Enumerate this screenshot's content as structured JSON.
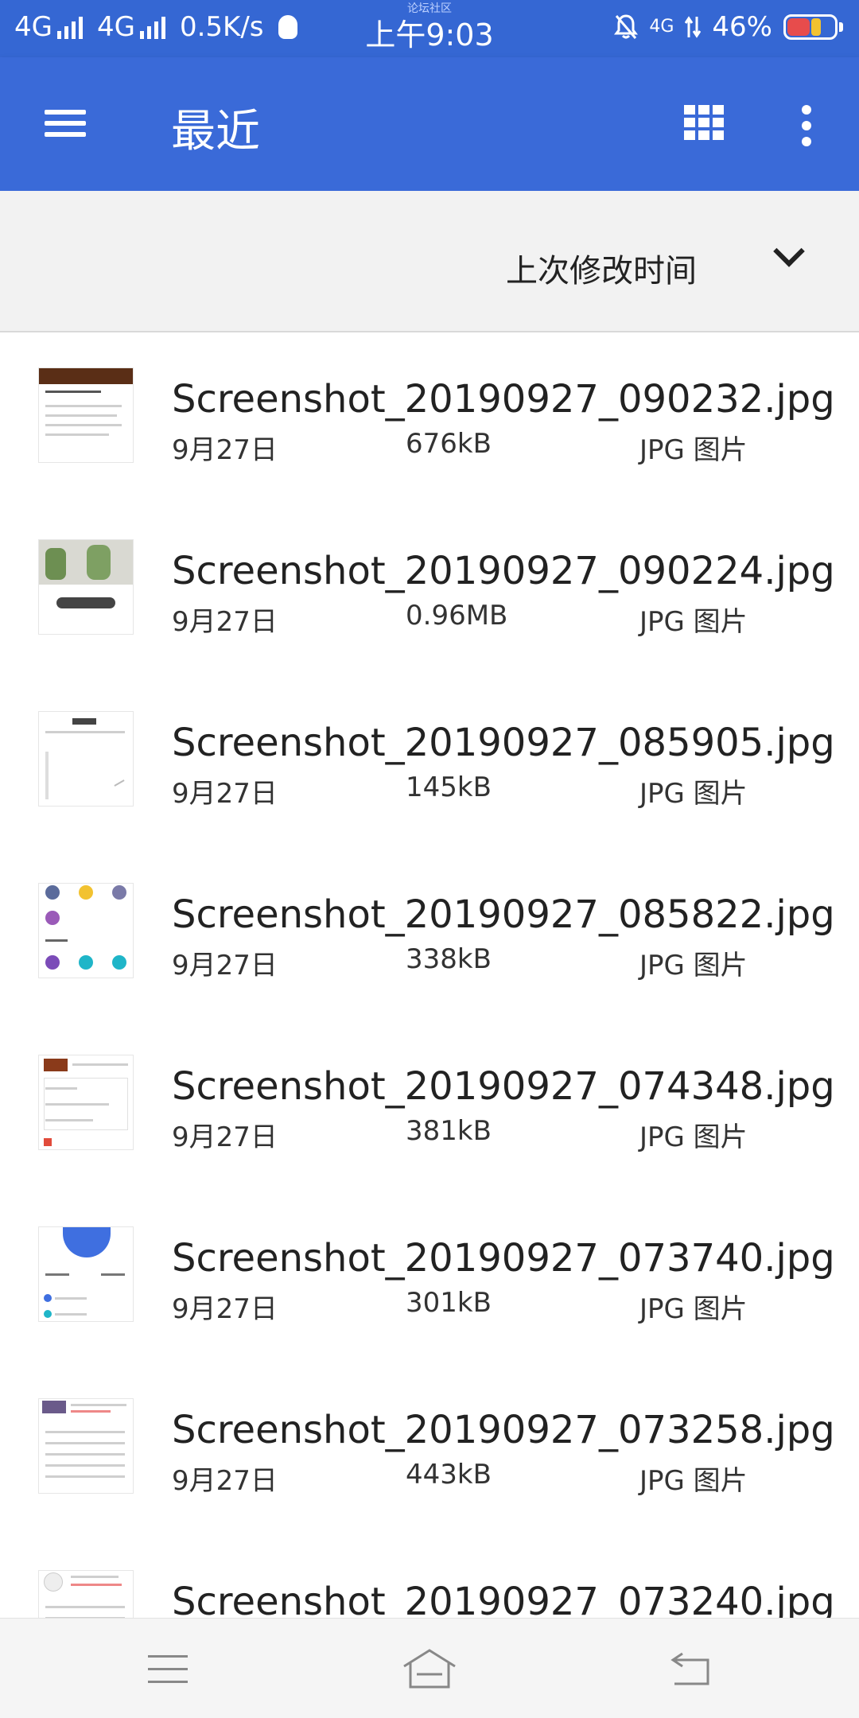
{
  "status_bar": {
    "net1": "4G",
    "net2": "4G",
    "speed": "0.5K/s",
    "time": "上午9:03",
    "community": "论坛社区",
    "net3": "4G",
    "battery": "46%",
    "battery_level": 0.46
  },
  "app_bar": {
    "title": "最近",
    "menu_icon": "hamburger-menu-icon",
    "grid_icon": "grid-view-icon",
    "more_icon": "more-vert-icon",
    "accent_color": "#3a6ad8"
  },
  "sort": {
    "label": "上次修改时间",
    "icon": "chevron-down-icon"
  },
  "files": [
    {
      "name": "Screenshot_20190927_090232.jpg",
      "date": "9月27日",
      "size": "676kB",
      "type": "JPG 图片"
    },
    {
      "name": "Screenshot_20190927_090224.jpg",
      "date": "9月27日",
      "size": "0.96MB",
      "type": "JPG 图片"
    },
    {
      "name": "Screenshot_20190927_085905.jpg",
      "date": "9月27日",
      "size": "145kB",
      "type": "JPG 图片"
    },
    {
      "name": "Screenshot_20190927_085822.jpg",
      "date": "9月27日",
      "size": "338kB",
      "type": "JPG 图片"
    },
    {
      "name": "Screenshot_20190927_074348.jpg",
      "date": "9月27日",
      "size": "381kB",
      "type": "JPG 图片"
    },
    {
      "name": "Screenshot_20190927_073740.jpg",
      "date": "9月27日",
      "size": "301kB",
      "type": "JPG 图片"
    },
    {
      "name": "Screenshot_20190927_073258.jpg",
      "date": "9月27日",
      "size": "443kB",
      "type": "JPG 图片"
    },
    {
      "name": "Screenshot_20190927_073240.jpg",
      "date": "",
      "size": "",
      "type": ""
    }
  ],
  "nav_bar": {
    "menu_icon": "nav-menu-icon",
    "home_icon": "home-icon",
    "back_icon": "back-icon"
  }
}
